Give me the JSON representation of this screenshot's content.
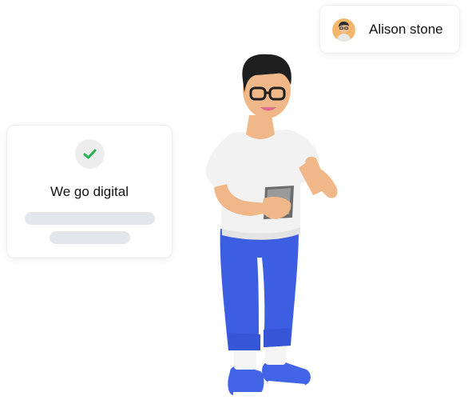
{
  "profile": {
    "name": "Alison stone",
    "avatar_icon": "person-avatar-icon"
  },
  "status_card": {
    "icon": "checkmark-icon",
    "title": "We go digital",
    "accent_color": "#22b455"
  },
  "illustration": {
    "subject": "person-holding-phone-illustration",
    "shirt_color": "#f2f2f2",
    "pants_color": "#3b5fe0",
    "shoe_color": "#4165e6"
  }
}
